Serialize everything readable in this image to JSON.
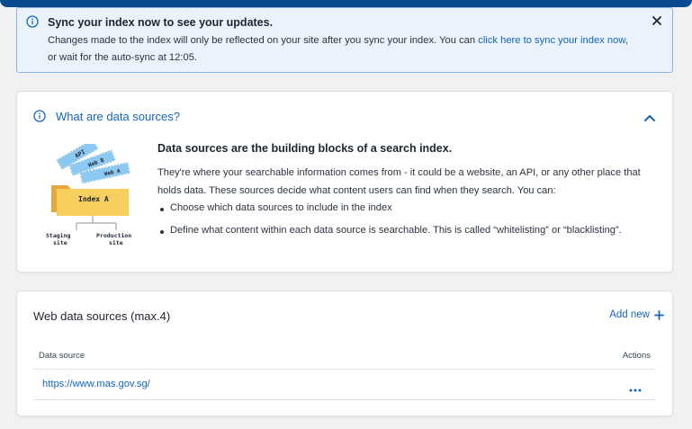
{
  "banner": {
    "title": "Sync your index now to see your updates.",
    "line1_text": "Changes made to the index will only be reflected on your site after you sync your index. You can ",
    "line1_link": "click here to sync your index now",
    "line1_end": ",",
    "line2": "or wait for the auto-sync at 12:05."
  },
  "data_sources_info": {
    "title": "What are data sources?",
    "heading": "Data sources are the building blocks of a search index.",
    "paragraph": "They're where your searchable information comes from - it could be a website, an API, or any other place that holds data. These sources decide what content users can find when they search. You can:",
    "bullets": [
      "Choose which data sources to include in the index",
      "Define what content within each data source is searchable. This is called “whitelisting” or “blacklisting”."
    ],
    "illustration": {
      "cards": [
        "API",
        "Web B",
        "Web A"
      ],
      "folder_label": "Index A",
      "staging": "Staging\nsite",
      "production": "Production\nsite"
    }
  },
  "web_sources": {
    "title": "Web data sources (max.4)",
    "add_new": "Add new",
    "columns": [
      "Data source",
      "Actions"
    ],
    "rows": [
      {
        "url": "https://www.mas.gov.sg/"
      }
    ]
  },
  "colors": {
    "primary": "#1466b8",
    "brand_bar": "#0a4a8f",
    "banner_bg": "#eaf2fb",
    "banner_border": "#8fb4de",
    "illus_blue": "#8cc9f0",
    "illus_yellow": "#f7cf5e"
  },
  "icons": [
    "info-icon",
    "close-icon",
    "chevron-up-icon",
    "plus-icon",
    "more-horizontal-icon"
  ]
}
